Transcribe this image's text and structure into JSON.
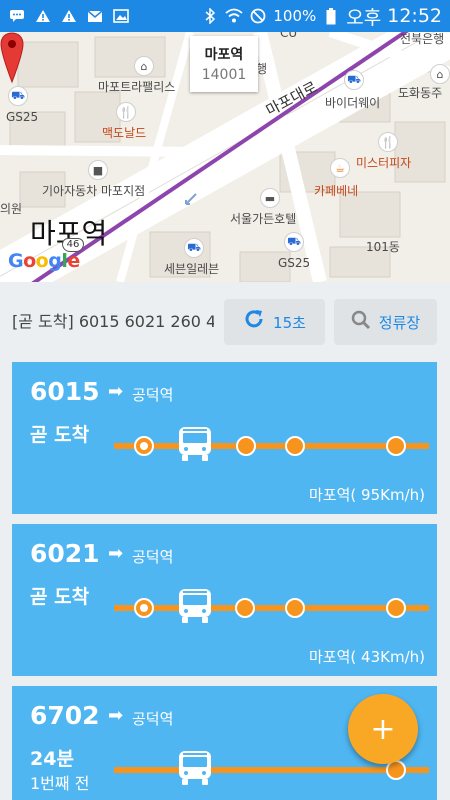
{
  "statusbar": {
    "left_icons": [
      "chat-icon",
      "warning-icon",
      "warning-icon",
      "mail-icon",
      "image-icon"
    ],
    "battery": "100%",
    "ampm": "오후",
    "time": "12:52"
  },
  "map": {
    "pois": {
      "cu": "CU",
      "jeonbuk_bank": "전북은행",
      "mapo_trapalace": "마포트라팰리스",
      "haeng": "행",
      "dohwa": "도화동주",
      "gs25_top": "GS25",
      "mcdonalds": "맥도날드",
      "mapo_daero": "마포대로",
      "byder": "바이더웨이",
      "mister_pizza": "미스터피자",
      "kia_motors": "기아자동차 마포지점",
      "cafe_bene": "카페베네",
      "uiwon": "의원",
      "seoul_garden": "서울가든호텔",
      "building_101": "101동",
      "seven_eleven": "세븐일레븐",
      "gs25_bottom": "GS25"
    },
    "station_name": "마포역",
    "route_number": "46",
    "google": [
      "G",
      "o",
      "o",
      "g",
      "l",
      "e"
    ],
    "infowindow": {
      "title": "마포역",
      "id": "14001"
    }
  },
  "controls": {
    "ticker": "[곧 도착] 6015  6021  260  4",
    "refresh_label": "15초",
    "stops_label": "정류장"
  },
  "buses": [
    {
      "number": "6015",
      "destination": "공덕역",
      "eta": "곧 도착",
      "eta_detail": "",
      "footer": "마포역( 95Km/h)"
    },
    {
      "number": "6021",
      "destination": "공덕역",
      "eta": "곧 도착",
      "eta_detail": "",
      "footer": "마포역( 43Km/h)"
    },
    {
      "number": "6702",
      "destination": "공덕역",
      "eta": "24분",
      "eta_detail": "1번째 전",
      "footer": ""
    }
  ],
  "fab": {
    "label": "+"
  }
}
